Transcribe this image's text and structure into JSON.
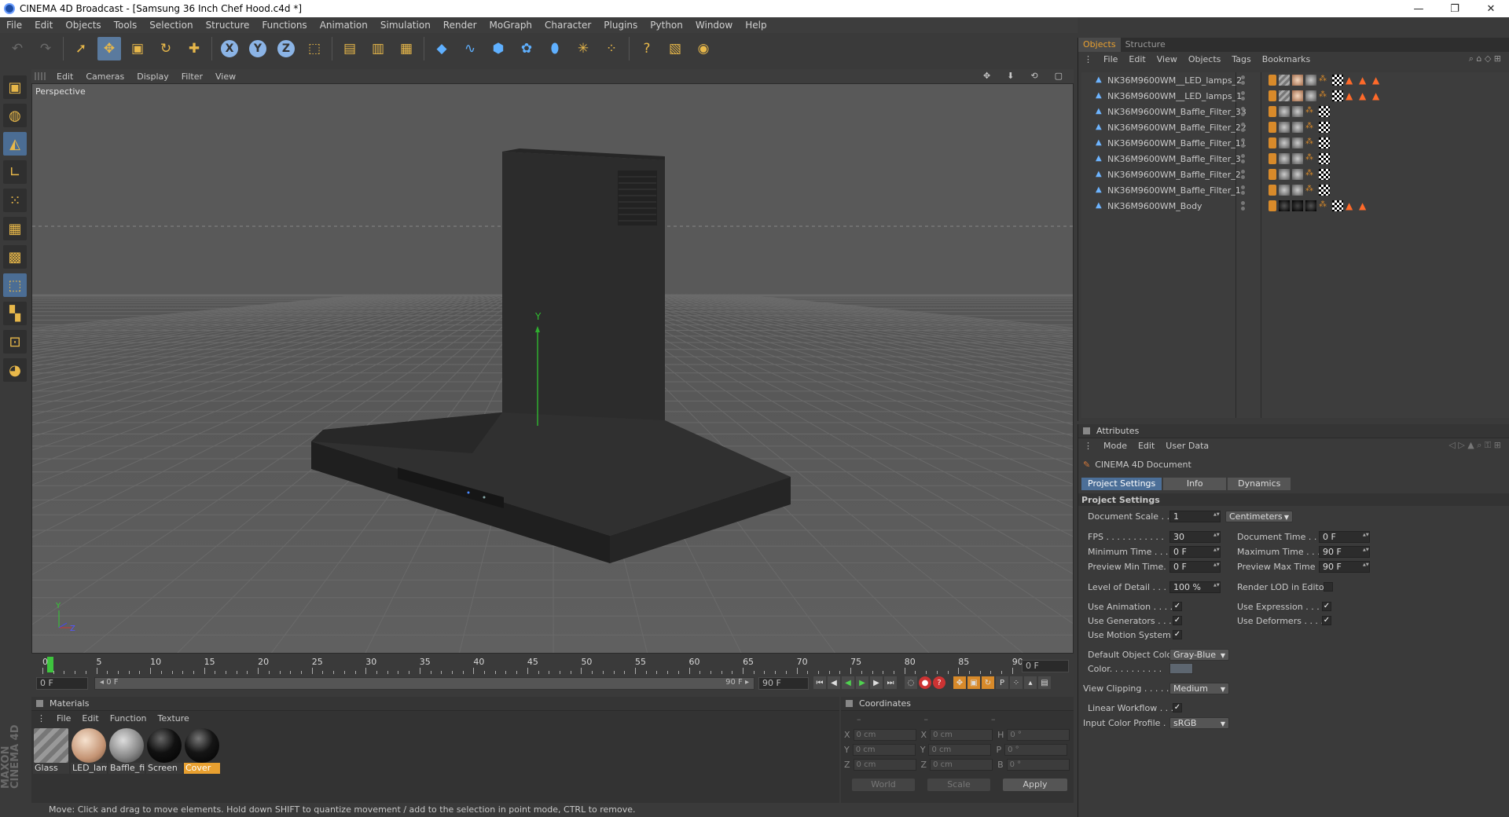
{
  "window": {
    "title": "CINEMA 4D Broadcast - [Samsung 36 Inch Chef Hood.c4d *]",
    "minimize": "—",
    "maximize": "❐",
    "close": "✕"
  },
  "menu": [
    "File",
    "Edit",
    "Objects",
    "Tools",
    "Selection",
    "Structure",
    "Functions",
    "Animation",
    "Simulation",
    "Render",
    "MoGraph",
    "Character",
    "Plugins",
    "Python",
    "Window",
    "Help"
  ],
  "viewport": {
    "menu": [
      "Edit",
      "Cameras",
      "Display",
      "Filter",
      "View"
    ],
    "label": "Perspective",
    "axis_y": "Y",
    "mini_axis": {
      "y": "Y",
      "z": "Z"
    }
  },
  "timeline": {
    "ticks": [
      "0",
      "5",
      "10",
      "15",
      "20",
      "25",
      "30",
      "35",
      "40",
      "45",
      "50",
      "55",
      "60",
      "65",
      "70",
      "75",
      "80",
      "85",
      "90"
    ],
    "current_frame": "0 F",
    "start_field": "0 F",
    "range_start": "◂ 0 F",
    "range_end": "90 F ▸",
    "end_field": "90 F"
  },
  "materials": {
    "title": "Materials",
    "menu": [
      "File",
      "Edit",
      "Function",
      "Texture"
    ],
    "items": [
      {
        "label": "Glass",
        "selected": false
      },
      {
        "label": "LED_lam",
        "selected": false
      },
      {
        "label": "Baffle_fil",
        "selected": false
      },
      {
        "label": "Screen",
        "selected": false
      },
      {
        "label": "Cover",
        "selected": true
      }
    ]
  },
  "coordinates": {
    "title": "Coordinates",
    "header": [
      "–",
      "–",
      "–"
    ],
    "rows": [
      {
        "a": "X",
        "av": "0 cm",
        "b": "X",
        "bv": "0 cm",
        "c": "H",
        "cv": "0 °"
      },
      {
        "a": "Y",
        "av": "0 cm",
        "b": "Y",
        "bv": "0 cm",
        "c": "P",
        "cv": "0 °"
      },
      {
        "a": "Z",
        "av": "0 cm",
        "b": "Z",
        "bv": "0 cm",
        "c": "B",
        "cv": "0 °"
      }
    ],
    "world": "World",
    "scale": "Scale",
    "apply": "Apply"
  },
  "status": "Move: Click and drag to move elements. Hold down SHIFT to quantize movement / add to the selection in point mode, CTRL to remove.",
  "branding": {
    "line1": "MAXON",
    "line2": "CINEMA 4D"
  },
  "objects_panel": {
    "tabs": [
      "Objects",
      "Structure"
    ],
    "menu": [
      "File",
      "Edit",
      "View",
      "Objects",
      "Tags",
      "Bookmarks"
    ],
    "items": [
      "NK36M9600WM__LED_lamps_2",
      "NK36M9600WM__LED_lamps_1",
      "NK36M9600WM_Baffle_Filter_33",
      "NK36M9600WM_Baffle_Filter_22",
      "NK36M9600WM_Baffle_Filter_11",
      "NK36M9600WM_Baffle_Filter_3",
      "NK36M9600WM_Baffle_Filter_2",
      "NK36M9600WM_Baffle_Filter_1",
      "NK36M9600WM_Body"
    ]
  },
  "attributes": {
    "title": "Attributes",
    "menu": [
      "Mode",
      "Edit",
      "User Data"
    ],
    "doc": "CINEMA 4D Document",
    "tabs": [
      "Project Settings",
      "Info",
      "Dynamics"
    ],
    "section": "Project Settings",
    "document_scale_label": "Document Scale . .",
    "document_scale": "1",
    "units": "Centimeters",
    "fps_label": "FPS . . . . . . . . . . .",
    "fps": "30",
    "doc_time_label": "Document Time . . . .",
    "doc_time": "0 F",
    "min_time_label": "Minimum Time . . . .",
    "min_time": "0 F",
    "max_time_label": "Maximum Time . . . .",
    "max_time": "90 F",
    "prev_min_label": "Preview Min Time. .",
    "prev_min": "0 F",
    "prev_max_label": "Preview Max Time . .",
    "prev_max": "90 F",
    "lod_label": "Level of Detail . . . .",
    "lod": "100 %",
    "render_lod_label": "Render LOD in Editor",
    "use_anim_label": "Use Animation . . . .",
    "use_expr_label": "Use Expression . . . .",
    "use_gen_label": "Use Generators . . .",
    "use_def_label": "Use Deformers . . . .",
    "use_motion_label": "Use Motion System",
    "check": "✓",
    "def_color_label": "Default Object Color",
    "def_color": "Gray-Blue",
    "color_label": "Color. . . . . . . . . .",
    "view_clip_label": "View Clipping . . . . .",
    "view_clip": "Medium",
    "linear_label": "Linear Workflow . . .",
    "profile_label": "Input Color Profile . .",
    "profile": "sRGB"
  },
  "colors": {
    "accent": "#e8a030",
    "selection": "#4c6f98",
    "bg": "#3a3a3a",
    "viewport": "#5b5b5b"
  }
}
